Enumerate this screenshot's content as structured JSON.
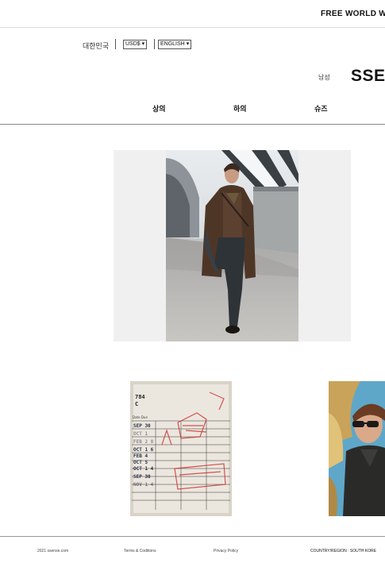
{
  "banner": {
    "text": "FREE WORLD WI"
  },
  "locale": {
    "country": "대한민국",
    "currency": "USD$",
    "language": "ENGLISH"
  },
  "header": {
    "gender": "남성",
    "logo": "SSEN"
  },
  "nav": {
    "items": [
      "상의",
      "하의",
      "슈즈"
    ]
  },
  "hero": {
    "image": "runway-model-brown-coat"
  },
  "tiles": [
    {
      "image": "library-date-due-card"
    },
    {
      "image": "model-in-sunglasses"
    }
  ],
  "footer": {
    "copyright": "2021 ssense.com",
    "terms": "Terms & Coditions",
    "privacy": "Privacy Policy",
    "region": "COUNTRY/REGION : SOUTH KORE"
  },
  "colors": {
    "text": "#111111",
    "divider": "#d9d9d9",
    "stamp_red": "#d0383a"
  }
}
